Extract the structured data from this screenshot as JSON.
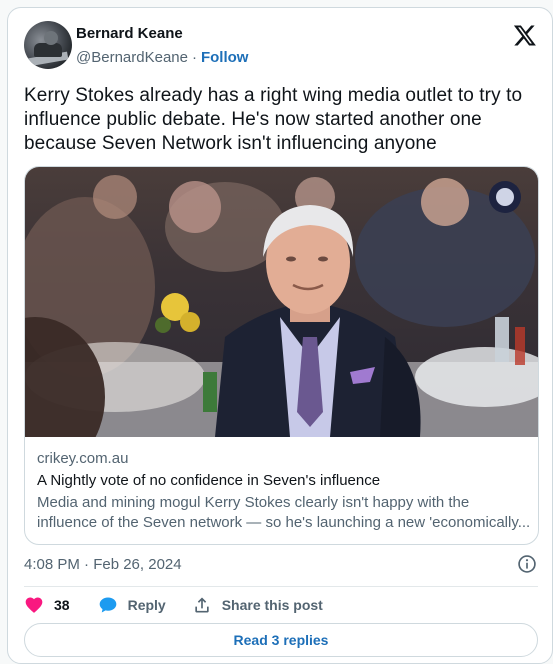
{
  "author": {
    "name": "Bernard Keane",
    "handle": "@BernardKeane",
    "separator": "·",
    "follow_label": "Follow"
  },
  "tweet": {
    "text": "Kerry Stokes already has a right wing media outlet to try to influence public debate. He's now started another one because Seven Network isn't influencing anyone"
  },
  "link_card": {
    "domain": "crikey.com.au",
    "title": "A Nightly vote of no confidence in Seven's influence",
    "description": "Media and mining mogul Kerry Stokes clearly isn't happy with the influence of the Seven network — so he's launching a new 'economically..."
  },
  "meta": {
    "timestamp": "4:08 PM · Feb 26, 2024"
  },
  "actions": {
    "like_count": "38",
    "reply_label": "Reply",
    "share_label": "Share this post"
  },
  "footer": {
    "read_replies_label": "Read 3 replies"
  },
  "colors": {
    "like": "#f91880",
    "reply": "#1d9bf0",
    "link": "#1d6fb8",
    "border": "#cfd9de",
    "muted": "#536471"
  },
  "icons": [
    "x-logo-icon",
    "heart-icon",
    "speech-bubble-icon",
    "share-upload-icon",
    "info-icon"
  ]
}
